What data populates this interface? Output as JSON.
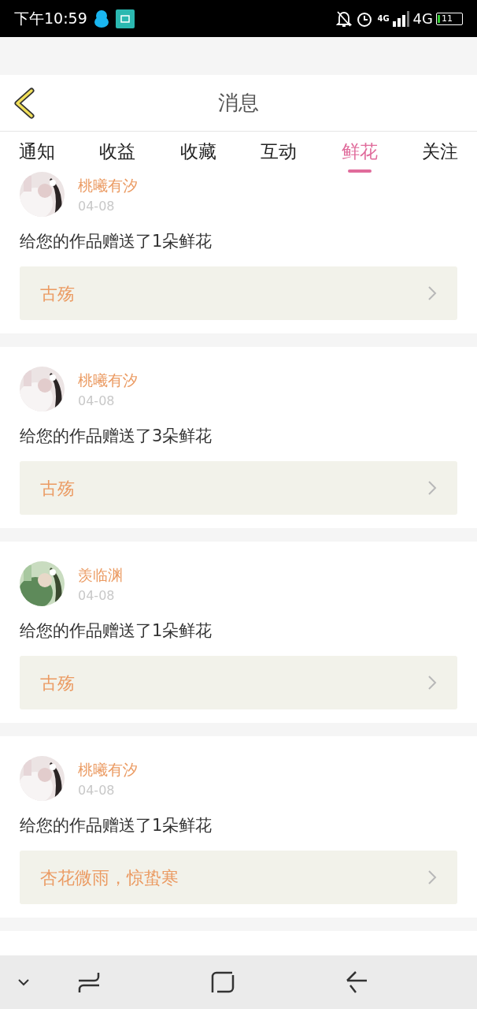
{
  "status_bar": {
    "time": "下午10:59",
    "network_small": "4G",
    "network": "4G",
    "battery": "11"
  },
  "header": {
    "title": "消息"
  },
  "tabs": [
    {
      "label": "通知",
      "selected": false
    },
    {
      "label": "收益",
      "selected": false
    },
    {
      "label": "收藏",
      "selected": false
    },
    {
      "label": "互动",
      "selected": false
    },
    {
      "label": "鲜花",
      "selected": true
    },
    {
      "label": "关注",
      "selected": false
    }
  ],
  "messages": [
    {
      "user": "桃曦有汐",
      "date": "04-08",
      "text": "给您的作品赠送了1朵鲜花",
      "work": "古殇"
    },
    {
      "user": "桃曦有汐",
      "date": "04-08",
      "text": "给您的作品赠送了3朵鲜花",
      "work": "古殇"
    },
    {
      "user": "羡临渊",
      "date": "04-08",
      "text": "给您的作品赠送了1朵鲜花",
      "work": "古殇"
    },
    {
      "user": "桃曦有汐",
      "date": "04-08",
      "text": "给您的作品赠送了1朵鲜花",
      "work": "杏花微雨，惊蛰寒"
    }
  ]
}
